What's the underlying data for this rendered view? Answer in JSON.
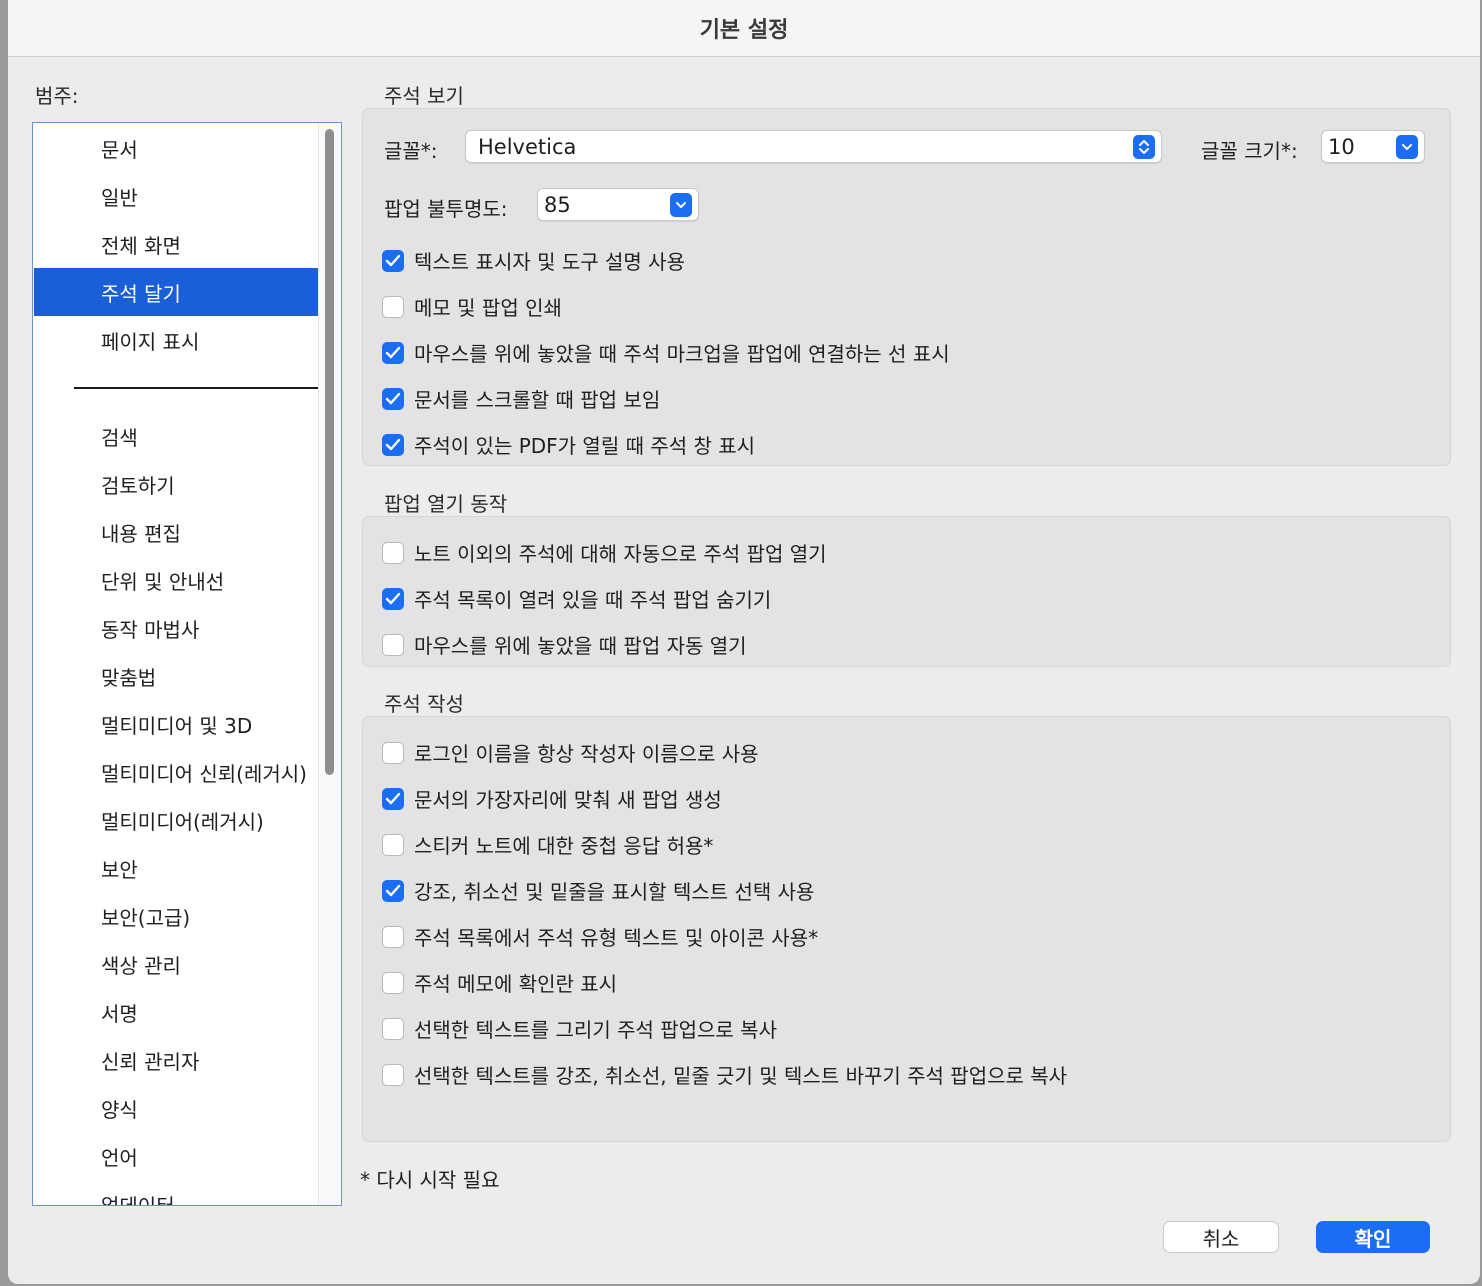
{
  "window": {
    "title": "기본 설정"
  },
  "sidebar": {
    "label": "범주:",
    "items": [
      {
        "label": "문서"
      },
      {
        "label": "일반"
      },
      {
        "label": "전체 화면"
      },
      {
        "label": "주석 달기",
        "selected": true
      },
      {
        "label": "페이지 표시"
      },
      {
        "label": "검색"
      },
      {
        "label": "검토하기"
      },
      {
        "label": "내용 편집"
      },
      {
        "label": "단위 및 안내선"
      },
      {
        "label": "동작 마법사"
      },
      {
        "label": "맞춤법"
      },
      {
        "label": "멀티미디어 및 3D"
      },
      {
        "label": "멀티미디어 신뢰(레거시)"
      },
      {
        "label": "멀티미디어(레거시)"
      },
      {
        "label": "보안"
      },
      {
        "label": "보안(고급)"
      },
      {
        "label": "색상 관리"
      },
      {
        "label": "서명"
      },
      {
        "label": "신뢰 관리자"
      },
      {
        "label": "양식"
      },
      {
        "label": "언어"
      },
      {
        "label": "업데이터"
      }
    ]
  },
  "view_section": {
    "title": "주석 보기",
    "font_label": "글꼴*:",
    "font_value": "Helvetica",
    "font_size_label": "글꼴 크기*:",
    "font_size_value": "10",
    "opacity_label": "팝업 불투명도:",
    "opacity_value": "85",
    "checkboxes": [
      {
        "label": "텍스트 표시자 및 도구 설명 사용",
        "checked": true
      },
      {
        "label": "메모 및 팝업 인쇄",
        "checked": false
      },
      {
        "label": "마우스를 위에 놓았을 때 주석 마크업을 팝업에 연결하는 선 표시",
        "checked": true
      },
      {
        "label": "문서를 스크롤할 때 팝업 보임",
        "checked": true
      },
      {
        "label": "주석이 있는 PDF가 열릴 때 주석 창 표시",
        "checked": true
      }
    ]
  },
  "popup_section": {
    "title": "팝업 열기 동작",
    "checkboxes": [
      {
        "label": "노트 이외의 주석에 대해 자동으로 주석 팝업 열기",
        "checked": false
      },
      {
        "label": "주석 목록이 열려 있을 때 주석 팝업 숨기기",
        "checked": true
      },
      {
        "label": "마우스를 위에 놓았을 때 팝업 자동 열기",
        "checked": false
      }
    ]
  },
  "create_section": {
    "title": "주석 작성",
    "checkboxes": [
      {
        "label": "로그인 이름을 항상 작성자 이름으로 사용",
        "checked": false
      },
      {
        "label": "문서의 가장자리에 맞춰 새 팝업 생성",
        "checked": true
      },
      {
        "label": "스티커 노트에 대한 중첩 응답 허용*",
        "checked": false
      },
      {
        "label": "강조, 취소선 및 밑줄을 표시할 텍스트 선택 사용",
        "checked": true
      },
      {
        "label": "주석 목록에서 주석 유형 텍스트 및 아이콘 사용*",
        "checked": false
      },
      {
        "label": "주석 메모에 확인란 표시",
        "checked": false
      },
      {
        "label": "선택한 텍스트를 그리기 주석 팝업으로 복사",
        "checked": false
      },
      {
        "label": "선택한 텍스트를 강조, 취소선, 밑줄 긋기 및 텍스트 바꾸기 주석 팝업으로 복사",
        "checked": false
      }
    ]
  },
  "footer": {
    "restart_note": "* 다시 시작 필요",
    "cancel_label": "취소",
    "ok_label": "확인"
  },
  "colors": {
    "accent": "#1b6ef3",
    "selection": "#1a5fd8"
  }
}
